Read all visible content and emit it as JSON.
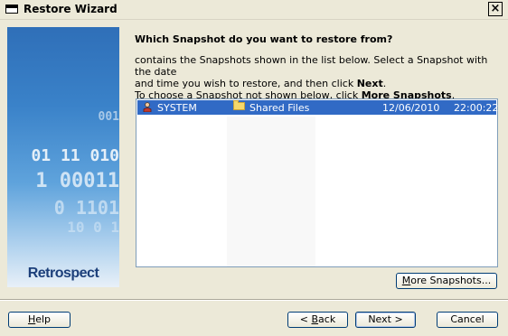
{
  "window": {
    "title": "Restore Wizard",
    "close_glyph": "×"
  },
  "side_graphic": {
    "digit_rows": [
      "001",
      "01 11 010",
      "1 00011",
      "0 1101",
      "10 0 1"
    ],
    "brand": "Retrospect"
  },
  "content": {
    "heading": "Which Snapshot do you want to restore from?",
    "instr_line1": " contains the Snapshots shown in the list below. Select a Snapshot with the date",
    "instr_line2_pre": "and time you wish to restore, and then click ",
    "instr_line2_bold": "Next",
    "instr_line2_post": ".",
    "instr_line3_pre": "To choose a Snapshot not shown below, click ",
    "instr_line3_bold": "More Snapshots",
    "instr_line3_post": "."
  },
  "snapshots": [
    {
      "user": "SYSTEM",
      "volume": "Shared Files",
      "date": "12/06/2010",
      "time": "22:00:22",
      "selected": true
    }
  ],
  "buttons": {
    "more": {
      "pre": "",
      "accel": "M",
      "post": "ore Snapshots..."
    },
    "help": {
      "pre": "",
      "accel": "H",
      "post": "elp"
    },
    "back": {
      "pre": "< ",
      "accel": "B",
      "post": "ack"
    },
    "next": {
      "pre": "Next >",
      "accel": "",
      "post": ""
    },
    "cancel": {
      "pre": "Cancel",
      "accel": "",
      "post": ""
    }
  },
  "colors": {
    "selection": "#316ac5",
    "dialog_bg": "#ece9d8",
    "graphic_blue": "#2f6fb8"
  },
  "icons": {
    "window": "window-icon",
    "user": "user-icon",
    "folder": "folder-icon"
  }
}
